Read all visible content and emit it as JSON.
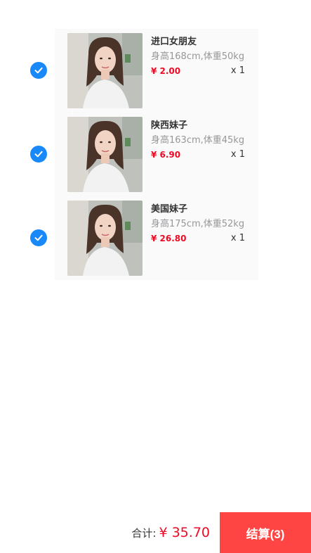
{
  "items": [
    {
      "title": "进口女朋友",
      "desc": "身高168cm,体重50kg",
      "price": "¥ 2.00",
      "qty": "x 1",
      "checked": true
    },
    {
      "title": "陕西妹子",
      "desc": "身高163cm,体重45kg",
      "price": "¥ 6.90",
      "qty": "x 1",
      "checked": true
    },
    {
      "title": "美国妹子",
      "desc": "身高175cm,体重52kg",
      "price": "¥ 26.80",
      "qty": "x 1",
      "checked": true
    }
  ],
  "submit_bar": {
    "total_label": "合计:",
    "total_value": "¥ 35.70",
    "checkout_label": "结算(3)"
  },
  "colors": {
    "accent": "#1989fa",
    "price": "#ee0a24",
    "checkout": "#ff4444"
  },
  "icons": {
    "checkbox": "check-circle-icon",
    "thumbnail": "portrait-photo"
  }
}
